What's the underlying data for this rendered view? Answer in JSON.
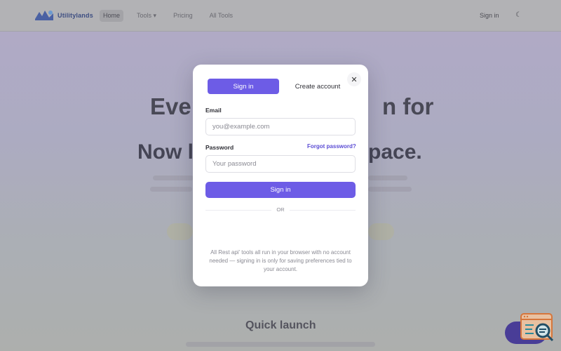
{
  "background": {
    "logo_text": "Utilitylands",
    "nav": [
      "Home",
      "Tools",
      "Pricing",
      "All Tools"
    ],
    "nav_signin": "Sign in",
    "theme_icon": "moon-icon",
    "hero_line1_left": "Ever",
    "hero_line1_right": "n for",
    "hero_line2_left": "Now l",
    "hero_line2_right": "pace.",
    "quick_launch_title": "Quick launch"
  },
  "modal": {
    "tabs": {
      "signin": "Sign in",
      "create": "Create account"
    },
    "close_icon": "close-icon",
    "email": {
      "label": "Email",
      "placeholder": "you@example.com",
      "value": ""
    },
    "password": {
      "label": "Password",
      "placeholder": "Your password",
      "value": ""
    },
    "forgot_label": "Forgot password?",
    "submit_label": "Sign in",
    "divider_text": "OR",
    "note": "All Rest api' tools all run in your browser with no account needed — signing in is only for saving preferences tied to your account."
  },
  "colors": {
    "accent": "#6d5ce6",
    "link": "#5a4bd4"
  }
}
